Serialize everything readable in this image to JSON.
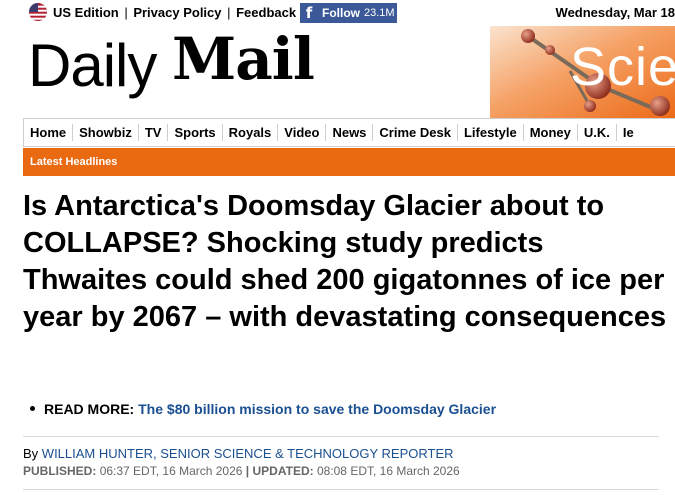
{
  "topbar": {
    "edition": "US Edition",
    "privacy": "Privacy Policy",
    "feedback": "Feedback",
    "facebook_label": "Follow",
    "facebook_count": "23.1M",
    "date": "Wednesday, Mar 18"
  },
  "masthead": {
    "logo_daily": "Daily",
    "logo_mail": "Mail",
    "section_banner": "Scie"
  },
  "nav": {
    "items": [
      "Home",
      "Showbiz",
      "TV",
      "Sports",
      "Royals",
      "Video",
      "News",
      "Crime Desk",
      "Lifestyle",
      "Money",
      "U.K.",
      "Ie"
    ]
  },
  "latest_bar": "Latest Headlines",
  "article": {
    "headline": "Is Antarctica's Doomsday Glacier about to COLLAPSE? Shocking study predicts Thwaites could shed 200 gigatonnes of ice per year by 2067 – with devastating consequences",
    "read_more_label": "READ MORE:",
    "read_more_link": "The $80 billion mission to save the Doomsday Glacier",
    "byline_prefix": "By",
    "author": "WILLIAM HUNTER, SENIOR SCIENCE & TECHNOLOGY REPORTER",
    "published_label": "PUBLISHED:",
    "published_time": "06:37 EDT, 16 March 2026",
    "separator": "|",
    "updated_label": "UPDATED:",
    "updated_time": "08:08 EDT, 16 March 2026"
  },
  "colors": {
    "accent_orange": "#ea6a12",
    "link_blue": "#1a4f91",
    "facebook_blue": "#3b5998"
  }
}
